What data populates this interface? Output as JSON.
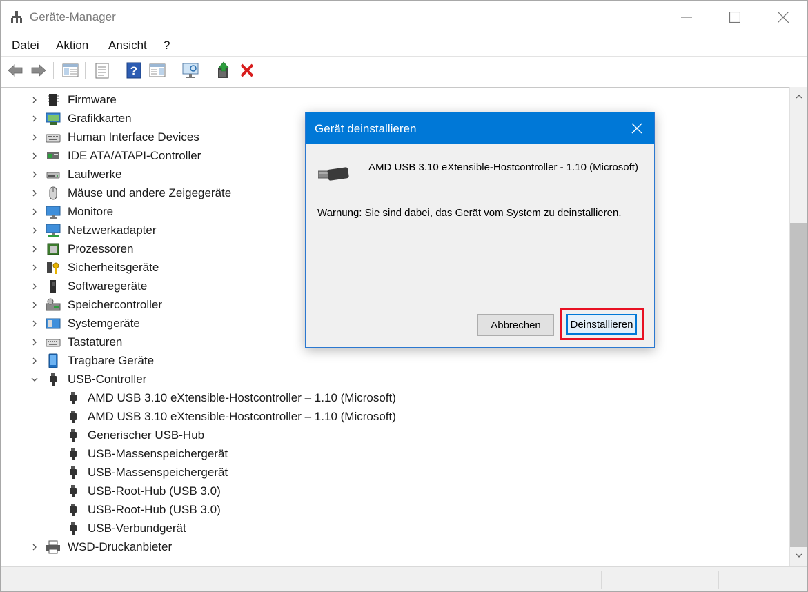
{
  "window": {
    "title": "Geräte-Manager",
    "controls": [
      "minimize",
      "maximize",
      "close"
    ]
  },
  "menu": [
    "Datei",
    "Aktion",
    "Ansicht",
    "?"
  ],
  "toolbar": [
    {
      "icon": "back-arrow-icon"
    },
    {
      "icon": "forward-arrow-icon"
    },
    {
      "icon": "show-hide-console-tree-icon"
    },
    {
      "icon": "properties-icon"
    },
    {
      "icon": "help-icon"
    },
    {
      "icon": "action-pane-icon"
    },
    {
      "icon": "scan-hardware-icon"
    },
    {
      "icon": "update-driver-icon"
    },
    {
      "icon": "uninstall-device-icon"
    }
  ],
  "tree": [
    {
      "label": "Firmware",
      "icon": "firmware-chip-icon",
      "expanded": false
    },
    {
      "label": "Grafikkarten",
      "icon": "display-adapter-icon",
      "expanded": false
    },
    {
      "label": "Human Interface Devices",
      "icon": "hid-keyboard-icon",
      "expanded": false
    },
    {
      "label": "IDE ATA/ATAPI-Controller",
      "icon": "ide-controller-icon",
      "expanded": false
    },
    {
      "label": "Laufwerke",
      "icon": "disk-drive-icon",
      "expanded": false
    },
    {
      "label": "Mäuse und andere Zeigegeräte",
      "icon": "mouse-icon",
      "expanded": false
    },
    {
      "label": "Monitore",
      "icon": "monitor-icon",
      "expanded": false
    },
    {
      "label": "Netzwerkadapter",
      "icon": "network-adapter-icon",
      "expanded": false
    },
    {
      "label": "Prozessoren",
      "icon": "processor-icon",
      "expanded": false
    },
    {
      "label": "Sicherheitsgeräte",
      "icon": "security-device-icon",
      "expanded": false
    },
    {
      "label": "Softwaregeräte",
      "icon": "software-device-icon",
      "expanded": false
    },
    {
      "label": "Speichercontroller",
      "icon": "storage-controller-icon",
      "expanded": false
    },
    {
      "label": "Systemgeräte",
      "icon": "system-device-icon",
      "expanded": false
    },
    {
      "label": "Tastaturen",
      "icon": "keyboard-icon",
      "expanded": false
    },
    {
      "label": "Tragbare Geräte",
      "icon": "portable-device-icon",
      "expanded": false
    },
    {
      "label": "USB-Controller",
      "icon": "usb-controller-icon",
      "expanded": true,
      "children": [
        "AMD USB 3.10 eXtensible-Hostcontroller – 1.10 (Microsoft)",
        "AMD USB 3.10 eXtensible-Hostcontroller – 1.10 (Microsoft)",
        "Generischer USB-Hub",
        "USB-Massenspeichergerät",
        "USB-Massenspeichergerät",
        "USB-Root-Hub (USB 3.0)",
        "USB-Root-Hub (USB 3.0)",
        "USB-Verbundgerät"
      ]
    },
    {
      "label": "WSD-Druckanbieter",
      "icon": "printer-icon",
      "expanded": false
    }
  ],
  "dialog": {
    "title": "Gerät deinstallieren",
    "device_name": "AMD USB 3.10 eXtensible-Hostcontroller - 1.10 (Microsoft)",
    "warning": "Warnung: Sie sind dabei, das Gerät vom System zu deinstallieren.",
    "cancel_label": "Abbrechen",
    "uninstall_label": "Deinstallieren",
    "highlight_color": "#e81123",
    "titlebar_color": "#0078d7"
  }
}
